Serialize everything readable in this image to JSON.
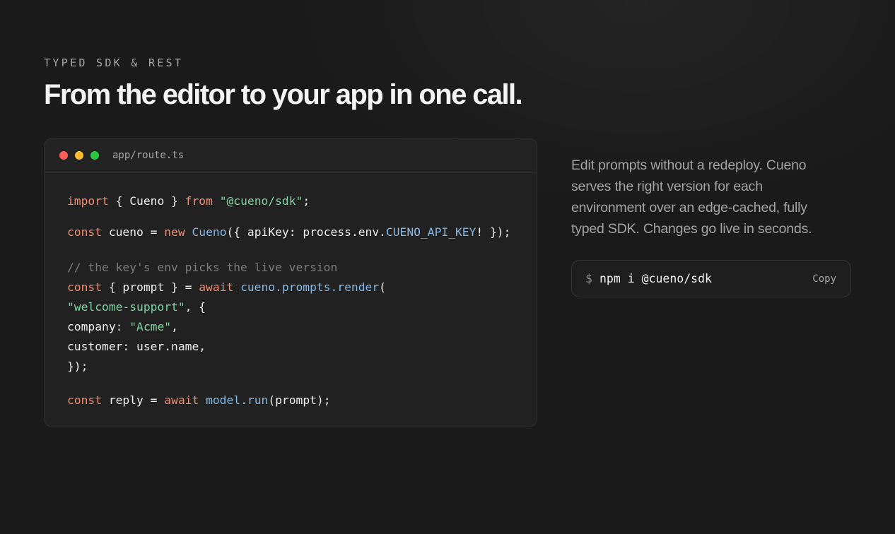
{
  "eyebrow": "TYPED SDK & REST",
  "headline": "From the editor to your app in one call.",
  "code_window": {
    "filename": "app/route.ts",
    "window_controls": [
      "close-dot",
      "minimize-dot",
      "maximize-dot"
    ],
    "lines": [
      {
        "tokens": [
          {
            "t": "import",
            "c": "kw"
          },
          {
            "t": " { Cueno } ",
            "c": "pl"
          },
          {
            "t": "from",
            "c": "kw"
          },
          {
            "t": " ",
            "c": "pl"
          },
          {
            "t": "\"@cueno/sdk\"",
            "c": "str"
          },
          {
            "t": ";",
            "c": "pl"
          }
        ]
      },
      {
        "tokens": [
          {
            "t": "const",
            "c": "kw"
          },
          {
            "t": " cueno = ",
            "c": "pl"
          },
          {
            "t": "new",
            "c": "kw"
          },
          {
            "t": " ",
            "c": "pl"
          },
          {
            "t": "Cueno",
            "c": "fn"
          },
          {
            "t": "({ apiKey: process.env.",
            "c": "pl"
          },
          {
            "t": "CUENO_API_KEY",
            "c": "fn"
          },
          {
            "t": "! });",
            "c": "pl"
          }
        ]
      },
      {
        "tokens": [
          {
            "t": "// the key's env picks the live version",
            "c": "cm"
          }
        ]
      },
      {
        "tokens": [
          {
            "t": "const",
            "c": "kw"
          },
          {
            "t": " { prompt } = ",
            "c": "pl"
          },
          {
            "t": "await",
            "c": "kw"
          },
          {
            "t": " ",
            "c": "pl"
          },
          {
            "t": "cueno.prompts.render",
            "c": "fn"
          },
          {
            "t": "(",
            "c": "pl"
          }
        ]
      },
      {
        "tokens": [
          {
            "t": "\"welcome-support\"",
            "c": "str"
          },
          {
            "t": ", {",
            "c": "pl"
          }
        ]
      },
      {
        "tokens": [
          {
            "t": "company: ",
            "c": "pl"
          },
          {
            "t": "\"Acme\"",
            "c": "str"
          },
          {
            "t": ",",
            "c": "pl"
          }
        ]
      },
      {
        "tokens": [
          {
            "t": "customer: user.name,",
            "c": "pl"
          }
        ]
      },
      {
        "tokens": [
          {
            "t": "});",
            "c": "pl"
          }
        ]
      },
      {
        "tokens": [
          {
            "t": "const",
            "c": "kw"
          },
          {
            "t": " reply = ",
            "c": "pl"
          },
          {
            "t": "await",
            "c": "kw"
          },
          {
            "t": " ",
            "c": "pl"
          },
          {
            "t": "model.run",
            "c": "fn"
          },
          {
            "t": "(prompt);",
            "c": "pl"
          }
        ]
      }
    ]
  },
  "syntax_colors": {
    "keyword": "#f08c70",
    "string": "#7ed3a0",
    "function": "#86b8e6",
    "comment": "#7b7b7b",
    "plain": "#efefef"
  },
  "description": "Edit prompts without a redeploy. Cueno serves the right version for each environment over an edge-cached, fully typed SDK. Changes go live in seconds.",
  "install": {
    "prompt_symbol": "$",
    "command": "npm i @cueno/sdk",
    "copy_label": "Copy"
  }
}
